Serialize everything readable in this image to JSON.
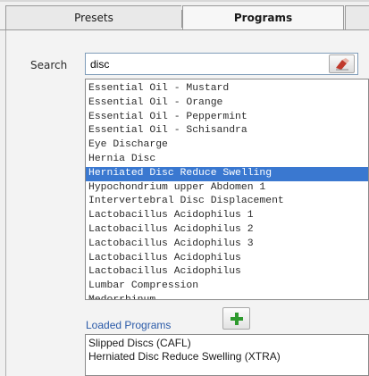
{
  "tabs": [
    {
      "label": "Presets"
    },
    {
      "label": "Programs"
    },
    {
      "label": ""
    }
  ],
  "search": {
    "label": "Search",
    "value": "disc"
  },
  "program_list": {
    "items": [
      {
        "label": "Essential Oil - Mustard"
      },
      {
        "label": "Essential Oil - Orange"
      },
      {
        "label": "Essential Oil - Peppermint"
      },
      {
        "label": "Essential Oil - Schisandra"
      },
      {
        "label": "Eye Discharge"
      },
      {
        "label": "Hernia Disc"
      },
      {
        "label": "Herniated Disc Reduce Swelling"
      },
      {
        "label": "Hypochondrium upper Abdomen 1"
      },
      {
        "label": "Intervertebral Disc Displacement"
      },
      {
        "label": "Lactobacillus Acidophilus 1"
      },
      {
        "label": "Lactobacillus Acidophilus 2"
      },
      {
        "label": "Lactobacillus Acidophilus 3"
      },
      {
        "label": "Lactobacillus Acidophilus"
      },
      {
        "label": "Lactobacillus Acidophilus"
      },
      {
        "label": "Lumbar Compression"
      },
      {
        "label": "Medorrhinum"
      }
    ],
    "selected_item": "Herniated Disc Reduce Swelling"
  },
  "loaded_programs": {
    "label": "Loaded Programs",
    "items": [
      {
        "label": "Slipped Discs (CAFL)"
      },
      {
        "label": "Herniated Disc Reduce Swelling (XTRA)"
      }
    ]
  },
  "colors": {
    "selection": "#3a78d0",
    "loaded_label": "#2a5aa8",
    "add_icon": "#2e9a2e",
    "clear_icon": "#c0392b"
  },
  "icons": {
    "clear": "eraser-icon",
    "add": "plus-icon"
  }
}
